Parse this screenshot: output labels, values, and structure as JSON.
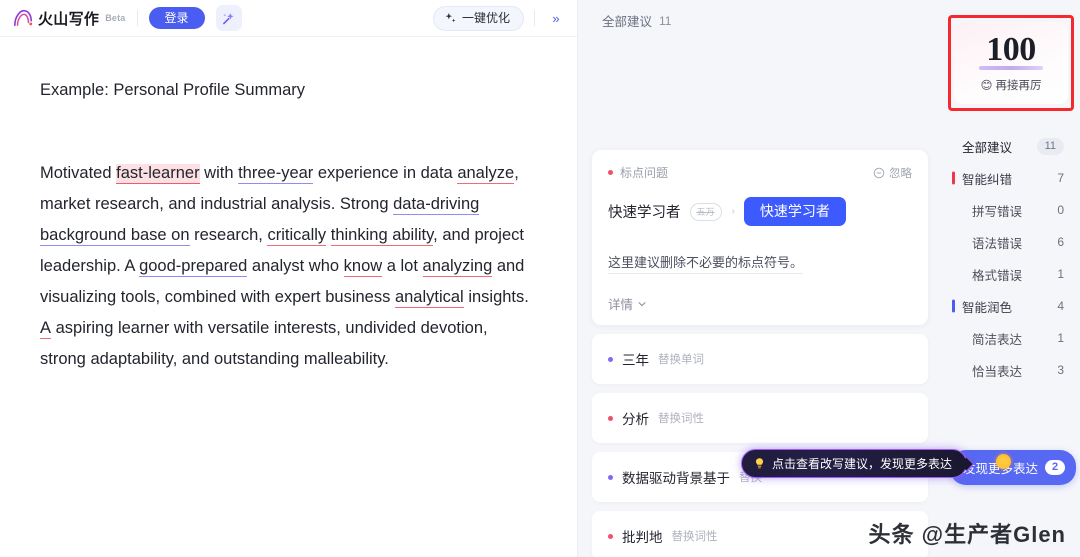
{
  "header": {
    "brand_name": "火山写作",
    "beta_tag": "Beta",
    "login_label": "登录",
    "wand_icon": "magic-wand-icon",
    "optimize_label": "一键优化",
    "optimize_icon": "sparkle-icon",
    "collapse_icon": "double-chevron-right-icon"
  },
  "document": {
    "title": "Example: Personal Profile Summary",
    "paragraph": {
      "t1": "Motivated ",
      "m1": "fast-learner",
      "t2": " with ",
      "m2": "three-year",
      "t3": " experience in data ",
      "m3": "analyze",
      "t4": ", market research, and industrial analysis. Strong ",
      "m4": "data-driving background base on",
      "t5": " research, ",
      "m5": "critically",
      "t6": " ",
      "m6": "thinking ability",
      "t7": ", and project leadership. A ",
      "m7": "good-prepared",
      "t8": " analyst who ",
      "m8": "know",
      "t9": " a lot ",
      "m9": "analyzing",
      "t10": " and visualizing tools, combined with expert business ",
      "m10": "analytical",
      "t11": " insights. ",
      "m11": "A",
      "t12": " aspiring learner with versatile interests, undivided devotion, strong adaptability, and outstanding malleability."
    }
  },
  "suggest_panel": {
    "header_label": "全部建议",
    "header_count": "11",
    "active_card": {
      "tag_label": "标点问题",
      "tag_color": "#f0506a",
      "ignore_label": "忽略",
      "ignore_icon": "circle-minus-icon",
      "original_text": "快速学习者",
      "strike_text": "五万",
      "replacement_label": "快速学习者",
      "description": "这里建议删除不必要的标点符号。",
      "more_label": "详情",
      "more_icon": "chevron-down-icon"
    },
    "items": [
      {
        "word": "三年",
        "kind": "替换单词",
        "dot_color": "#7a6ef0"
      },
      {
        "word": "分析",
        "kind": "替换词性",
        "dot_color": "#f0506a"
      },
      {
        "word": "数据驱动背景基于",
        "kind": "替换",
        "dot_color": "#7a6ef0"
      },
      {
        "word": "批判地",
        "kind": "替换词性",
        "dot_color": "#f0506a"
      }
    ],
    "tooltip": {
      "icon": "lightbulb-icon",
      "text": "点击查看改写建议，发现更多表达"
    }
  },
  "sidebar": {
    "score": {
      "value": "100",
      "emoji": "😊",
      "caption": "再接再厉",
      "annotation_color": "#f5282d"
    },
    "rows": [
      {
        "label": "全部建议",
        "value": "11",
        "level": 1,
        "bar": "none",
        "pill": true
      },
      {
        "label": "智能纠错",
        "value": "7",
        "level": 1,
        "bar": "red",
        "pill": false
      },
      {
        "label": "拼写错误",
        "value": "0",
        "level": 2,
        "bar": "none",
        "pill": false
      },
      {
        "label": "语法错误",
        "value": "6",
        "level": 2,
        "bar": "none",
        "pill": false
      },
      {
        "label": "格式错误",
        "value": "1",
        "level": 2,
        "bar": "none",
        "pill": false
      },
      {
        "label": "智能润色",
        "value": "4",
        "level": 1,
        "bar": "blue",
        "pill": false
      },
      {
        "label": "简洁表达",
        "value": "1",
        "level": 2,
        "bar": "none",
        "pill": false
      },
      {
        "label": "恰当表达",
        "value": "3",
        "level": 2,
        "bar": "none",
        "pill": false
      }
    ],
    "discover": {
      "label": "发现更多表达",
      "badge": "2"
    }
  },
  "watermark": {
    "logo": "头条",
    "handle": "@生产者Glen"
  }
}
